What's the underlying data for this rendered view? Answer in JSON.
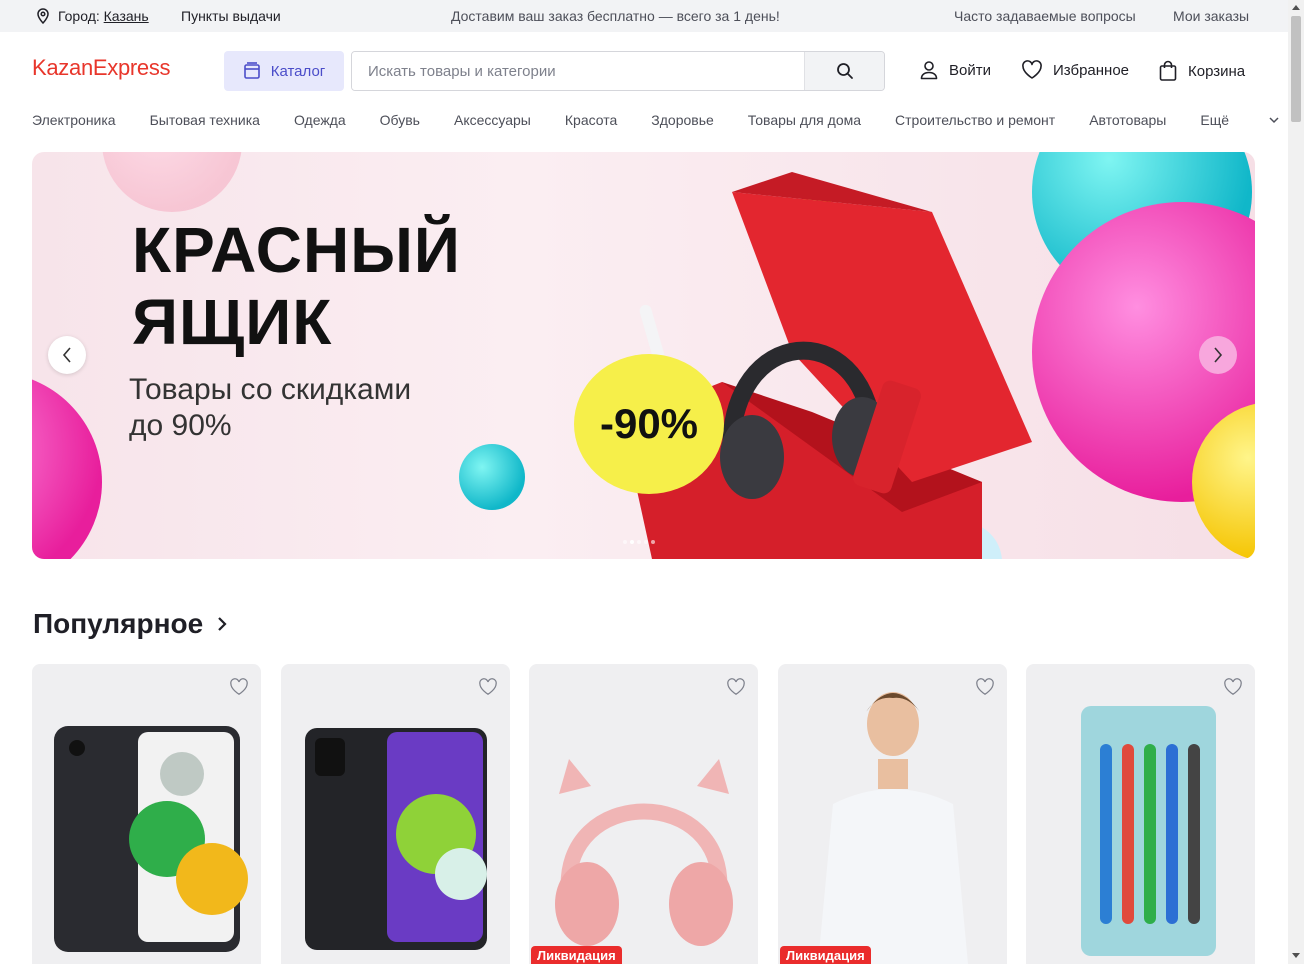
{
  "topbar": {
    "city_prefix": "Город:",
    "city": "Казань",
    "pickup": "Пункты выдачи",
    "promo": "Доставим ваш заказ бесплатно — всего за 1 день!",
    "faq": "Часто задаваемые вопросы",
    "orders": "Мои заказы"
  },
  "header": {
    "logo": "KazanExpress",
    "catalog": "Каталог",
    "search_placeholder": "Искать товары и категории",
    "login": "Войти",
    "favorites": "Избранное",
    "cart": "Корзина"
  },
  "categories": [
    "Электроника",
    "Бытовая техника",
    "Одежда",
    "Обувь",
    "Аксессуары",
    "Красота",
    "Здоровье",
    "Товары для дома",
    "Строительство и ремонт",
    "Автотовары"
  ],
  "categories_more": "Ещё",
  "banner": {
    "title_line1": "КРАСНЫЙ",
    "title_line2": "ЯЩИК",
    "subtitle_line1": "Товары со скидками",
    "subtitle_line2": "до 90%",
    "badge": "-90%",
    "slides_count": 5,
    "active_slide": 1
  },
  "popular": {
    "title": "Популярное"
  },
  "products": [
    {
      "image": "smartphone-samsung-a03-black",
      "tag": ""
    },
    {
      "image": "smartphone-samsung-a22-black",
      "tag": ""
    },
    {
      "image": "headphones-cat-ears-pink",
      "tag": "Ликвидация"
    },
    {
      "image": "mens-white-shirt",
      "tag": "Ликвидация"
    },
    {
      "image": "toothbrush-set",
      "tag": ""
    }
  ],
  "colors": {
    "brand": "#e8362b",
    "catalog_bg": "#e7e8fc",
    "catalog_text": "#4b4dc9",
    "tag_red": "#ea2c2c"
  }
}
